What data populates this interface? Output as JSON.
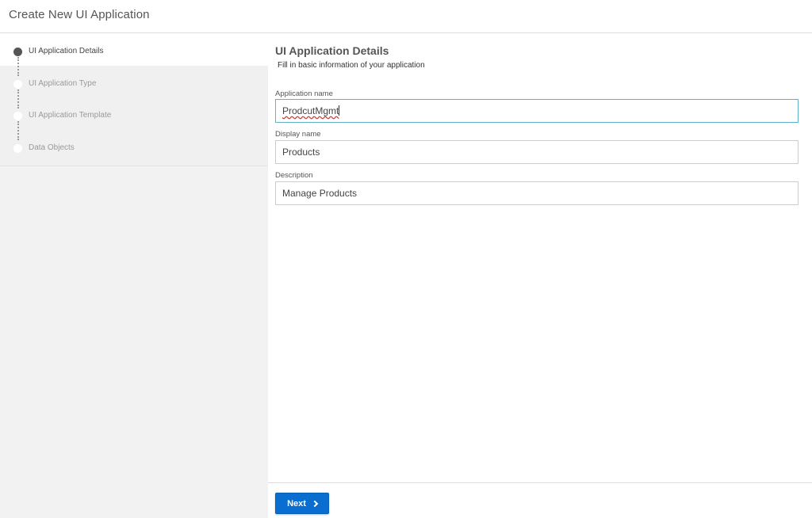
{
  "header": {
    "title": "Create New UI Application"
  },
  "wizard": {
    "steps": [
      {
        "label": "UI Application Details",
        "active": true
      },
      {
        "label": "UI Application Type",
        "active": false
      },
      {
        "label": "UI Application Template",
        "active": false
      },
      {
        "label": "Data Objects",
        "active": false
      }
    ]
  },
  "main": {
    "title": "UI Application Details",
    "subtitle": "Fill in basic information of your application",
    "fields": {
      "application_name": {
        "label": "Application name",
        "value": "ProdcutMgmt"
      },
      "display_name": {
        "label": "Display name",
        "value": "Products"
      },
      "description": {
        "label": "Description",
        "value": "Manage Products"
      }
    }
  },
  "footer": {
    "next_label": "Next",
    "next_icon": "chevron-right-icon"
  },
  "colors": {
    "accent": "#0a6ed1",
    "focus_border": "#5fb2c7",
    "active_step": "#555555"
  }
}
